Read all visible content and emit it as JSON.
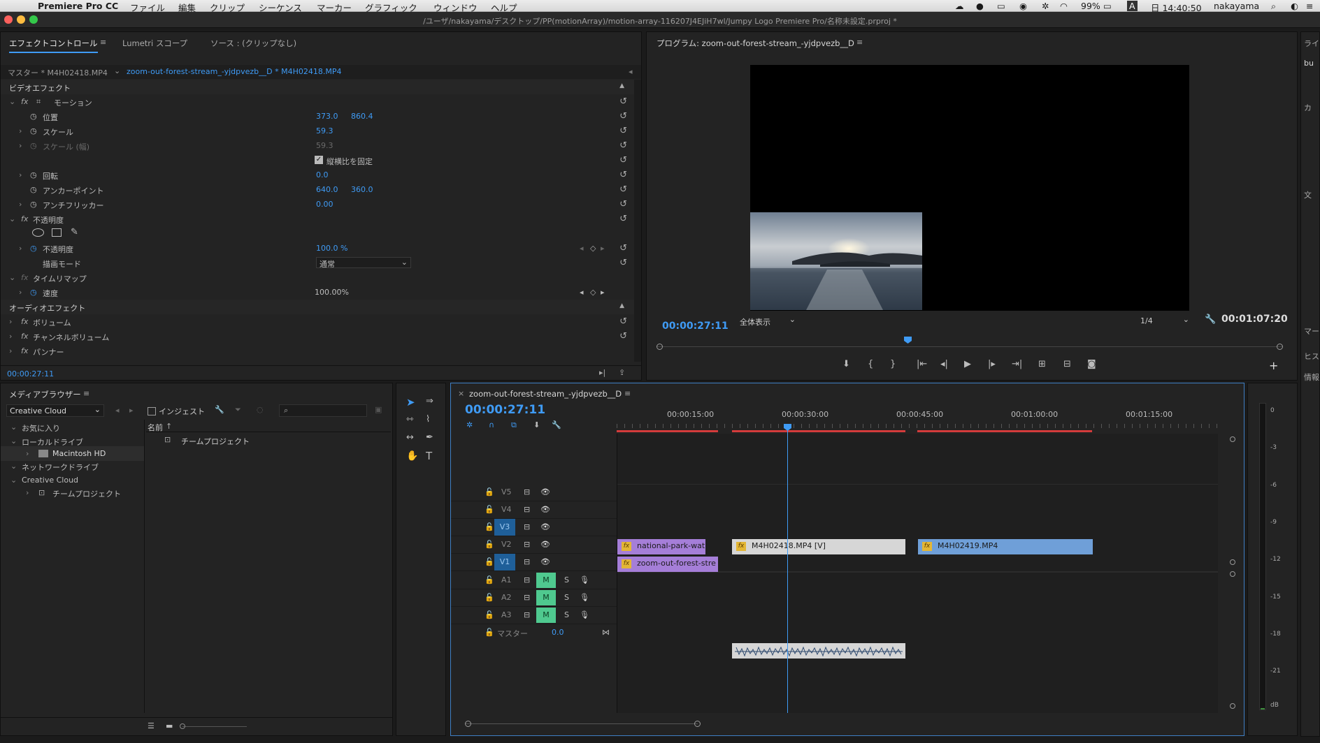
{
  "menubar": {
    "app": "Premiere Pro CC",
    "items": [
      "ファイル",
      "編集",
      "クリップ",
      "シーケンス",
      "マーカー",
      "グラフィック",
      "ウィンドウ",
      "ヘルプ"
    ],
    "battery": "99%",
    "time": "日 14:40:50",
    "user": "nakayama",
    "input_letter": "A"
  },
  "window": {
    "path": "/ユーザ/nakayama/デスクトップ/PP(motionArray)/motion-array-116207J4EJiH7wl/Jumpy Logo Premiere Pro/名称未設定.prproj *"
  },
  "effect_controls": {
    "tabs": [
      "エフェクトコントロール",
      "Lumetri スコープ",
      "ソース : (クリップなし)"
    ],
    "master_label": "マスター * M4H02418.MP4",
    "clip_link": "zoom-out-forest-stream_-yjdpvezb__D * M4H02418.MP4",
    "video_effects": "ビデオエフェクト",
    "motion": "モーション",
    "position_label": "位置",
    "position_x": "373.0",
    "position_y": "860.4",
    "scale_label": "スケール",
    "scale_value": "59.3",
    "scale_width_label": "スケール (幅)",
    "scale_width_value": "59.3",
    "uniform_scale": "縦横比を固定",
    "rotation_label": "回転",
    "rotation_value": "0.0",
    "anchor_label": "アンカーポイント",
    "anchor_x": "640.0",
    "anchor_y": "360.0",
    "antiflicker_label": "アンチフリッカー",
    "antiflicker_value": "0.00",
    "opacity_group": "不透明度",
    "opacity_label": "不透明度",
    "opacity_value": "100.0 %",
    "blend_label": "描画モード",
    "blend_value": "通常",
    "time_remap": "タイムリマップ",
    "speed_label": "速度",
    "speed_value": "100.00%",
    "audio_effects": "オーディオエフェクト",
    "volume": "ボリューム",
    "channel_volume": "チャンネルボリューム",
    "panner": "パンナー",
    "timecode": "00:00:27:11"
  },
  "program": {
    "title": "プログラム: zoom-out-forest-stream_-yjdpvezb__D",
    "timecode": "00:00:27:11",
    "fit": "全体表示",
    "resolution": "1/4",
    "duration": "00:01:07:20"
  },
  "right_panel": {
    "tab": "ライ",
    "items": [
      "bu",
      "カ",
      "文",
      "マー",
      "ヒス",
      "情報"
    ]
  },
  "media_browser": {
    "title": "メディアブラウザー",
    "source": "Creative Cloud",
    "ingest": "インジェスト",
    "col_name": "名前",
    "tree": [
      "お気に入り",
      "ローカルドライブ",
      "Macintosh HD",
      "ネットワークドライブ",
      "Creative Cloud",
      "チームプロジェクト"
    ],
    "file": "チームプロジェクト"
  },
  "timeline": {
    "title": "zoom-out-forest-stream_-yjdpvezb__D",
    "timecode": "00:00:27:11",
    "ruler": [
      "00:00:15:00",
      "00:00:30:00",
      "00:00:45:00",
      "00:01:00:00",
      "00:01:15:00"
    ],
    "video_tracks": [
      "V5",
      "V4",
      "V3",
      "V2",
      "V1"
    ],
    "audio_tracks": [
      "A1",
      "A2",
      "A3"
    ],
    "master_label": "マスター",
    "master_value": "0.0",
    "mute": "M",
    "solo": "S",
    "clips": {
      "v2a": "national-park-wat",
      "v2b": "M4H02418.MP4 [V]",
      "v2c": "M4H02419.MP4",
      "v1a": "zoom-out-forest-stre"
    }
  },
  "meter": {
    "scale": [
      "0",
      "-3",
      "-6",
      "-9",
      "-12",
      "-15",
      "-18",
      "-21",
      "dB"
    ]
  },
  "colors": {
    "accent": "#3f9bf5",
    "clip_purple": "#a57ed8",
    "clip_gray": "#d6d6d6",
    "clip_blue": "#6f9fd8",
    "mute_green": "#4fc98f",
    "track_active": "#1f5f99"
  }
}
